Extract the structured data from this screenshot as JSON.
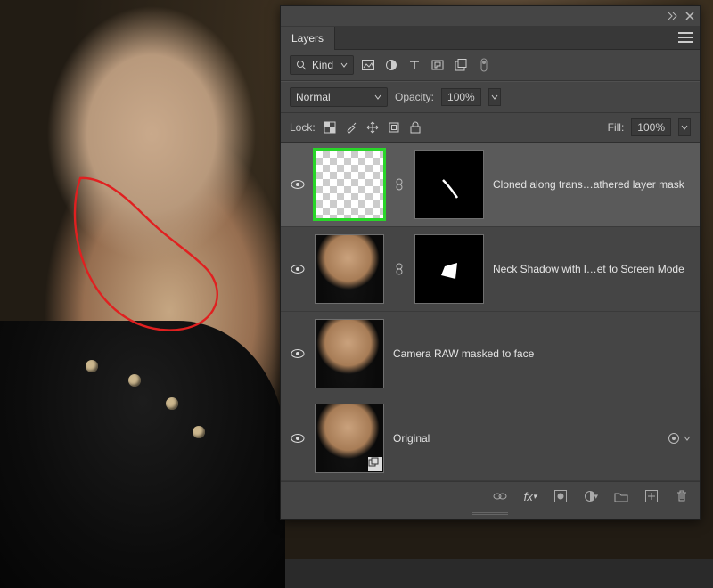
{
  "panel": {
    "title": "Layers",
    "filter_label": "Kind",
    "filter_icons": [
      "image-icon",
      "adjustment-icon",
      "type-icon",
      "shape-icon",
      "smartobject-icon",
      "artboard-icon"
    ],
    "blend_mode": "Normal",
    "opacity_label": "Opacity:",
    "opacity_value": "100%",
    "lock_label": "Lock:",
    "lock_icons": [
      "lock-transparency-icon",
      "lock-brush-icon",
      "lock-move-icon",
      "lock-artboard-icon",
      "lock-all-icon"
    ],
    "fill_label": "Fill:",
    "fill_value": "100%"
  },
  "layers": [
    {
      "name": "Cloned along trans…athered layer mask",
      "visible": true,
      "selected": true,
      "thumb": "transparent",
      "has_mask": true,
      "mask_shape": "stroke",
      "smart": false,
      "has_fx": false
    },
    {
      "name": "Neck Shadow with l…et to Screen Mode",
      "visible": true,
      "selected": false,
      "thumb": "portrait",
      "has_mask": true,
      "mask_shape": "blob",
      "smart": false,
      "has_fx": false
    },
    {
      "name": "Camera RAW masked to face",
      "visible": true,
      "selected": false,
      "thumb": "portrait",
      "has_mask": false,
      "smart": false,
      "has_fx": false
    },
    {
      "name": "Original",
      "visible": true,
      "selected": false,
      "thumb": "portrait",
      "has_mask": false,
      "smart": true,
      "has_fx": true
    }
  ],
  "footer_icons": [
    "link-layers-icon",
    "fx-icon",
    "mask-icon",
    "adjustment-layer-icon",
    "group-icon",
    "new-layer-icon",
    "trash-icon"
  ],
  "search_icon": "search-icon"
}
